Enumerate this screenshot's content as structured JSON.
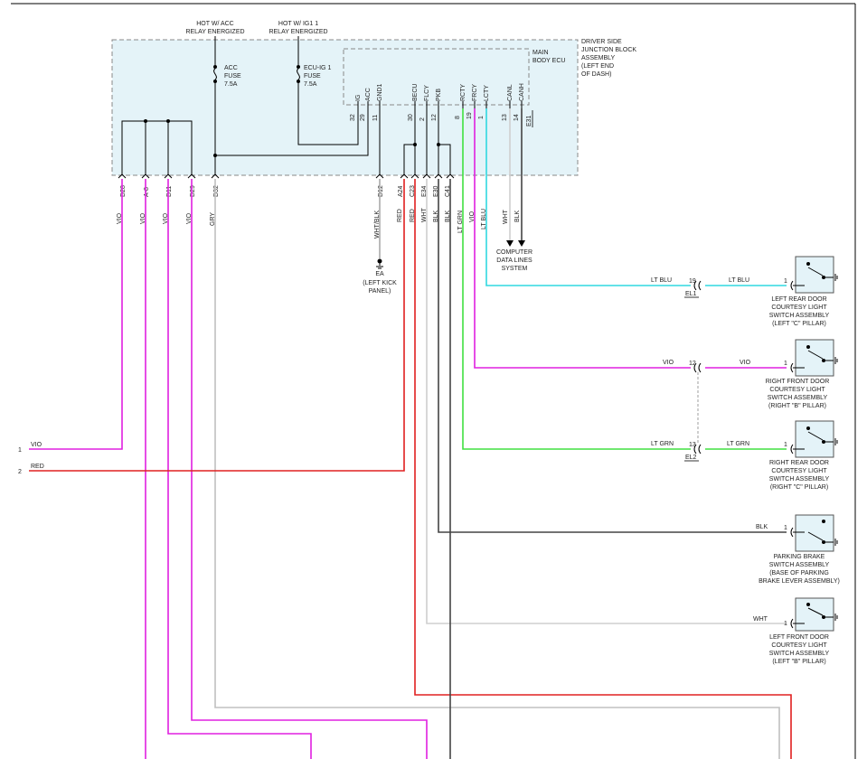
{
  "header": {
    "hot_acc": "HOT W/ ACC",
    "hot_acc_2": "RELAY ENERGIZED",
    "hot_ig1": "HOT W/ IG1 1",
    "hot_ig1_2": "RELAY ENERGIZED"
  },
  "junction_block": {
    "name_lines": [
      "DRIVER SIDE",
      "JUNCTION BLOCK",
      "ASSEMBLY",
      "(LEFT END",
      "OF DASH)"
    ],
    "fuse_acc": [
      "ACC",
      "FUSE",
      "7.5A"
    ],
    "fuse_ecu": [
      "ECU-IG 1",
      "FUSE",
      "7.5A"
    ]
  },
  "ecu": {
    "name_lines": [
      "MAIN",
      "BODY ECU"
    ],
    "pins": [
      {
        "name": "IG",
        "num": "32"
      },
      {
        "name": "ACC",
        "num": "29"
      },
      {
        "name": "GND1",
        "num": "11"
      },
      {
        "name": "BECU",
        "num": "30"
      },
      {
        "name": "FLCY",
        "num": "2"
      },
      {
        "name": "PKB",
        "num": "12"
      },
      {
        "name": "RCTY",
        "num": "8"
      },
      {
        "name": "FRCY",
        "num": "19"
      },
      {
        "name": "LCTY",
        "num": "1"
      },
      {
        "name": "CANL",
        "num": "13"
      },
      {
        "name": "CANH",
        "num": "14"
      }
    ],
    "connector": "E31"
  },
  "jb_connectors": [
    "D28",
    "A-8",
    "D11",
    "D29",
    "D32",
    "D12",
    "A24",
    "C23",
    "E34",
    "E30",
    "C41"
  ],
  "wire_colors": {
    "d28": "VIO",
    "a8": "VIO",
    "d11": "VIO",
    "d29": "VIO",
    "d32": "GRY",
    "d12": "WHT/BLK",
    "a24": "RED",
    "c23": "RED",
    "e34": "WHT",
    "e30": "BLK",
    "c41": "BLK",
    "rcty": "LT GRN",
    "frcy": "VIO",
    "lcty": "LT BLU",
    "canl": "WHT",
    "canh": "BLK"
  },
  "ground": {
    "name": "EA",
    "loc_lines": [
      "(LEFT KICK",
      "PANEL)"
    ]
  },
  "data_lines": [
    "COMPUTER",
    "DATA LINES",
    "SYSTEM"
  ],
  "left_terminals": [
    {
      "num": "1",
      "color": "VIO"
    },
    {
      "num": "2",
      "color": "RED"
    }
  ],
  "splice_connectors": {
    "el1": {
      "name": "EL1",
      "pin": "19"
    },
    "el2": {
      "name": "EL2",
      "pin_12": "12",
      "pin_13": "13"
    }
  },
  "switches": [
    {
      "lines": [
        "LEFT REAR DOOR",
        "COURTESY LIGHT",
        "SWITCH ASSEMBLY",
        "(LEFT \"C\" PILLAR)"
      ],
      "pin": "1",
      "wire_in": "LT BLU",
      "wire_out": "LT BLU"
    },
    {
      "lines": [
        "RIGHT FRONT DOOR",
        "COURTESY LIGHT",
        "SWITCH ASSEMBLY",
        "(RIGHT \"B\" PILLAR)"
      ],
      "pin": "1",
      "wire_in": "VIO",
      "wire_out": "VIO"
    },
    {
      "lines": [
        "RIGHT REAR DOOR",
        "COURTESY LIGHT",
        "SWITCH ASSEMBLY",
        "(RIGHT \"C\" PILLAR)"
      ],
      "pin": "1",
      "wire_in": "LT GRN",
      "wire_out": "LT GRN"
    },
    {
      "lines": [
        "PARKING BRAKE",
        "SWITCH ASSEMBLY",
        "(BASE OF PARKING",
        "BRAKE LEVER ASSEMBLY)"
      ],
      "pin": "1",
      "wire_in": "BLK"
    },
    {
      "lines": [
        "LEFT FRONT DOOR",
        "COURTESY LIGHT",
        "SWITCH ASSEMBLY",
        "(LEFT \"B\" PILLAR)"
      ],
      "pin": "1",
      "wire_in": "WHT"
    }
  ]
}
